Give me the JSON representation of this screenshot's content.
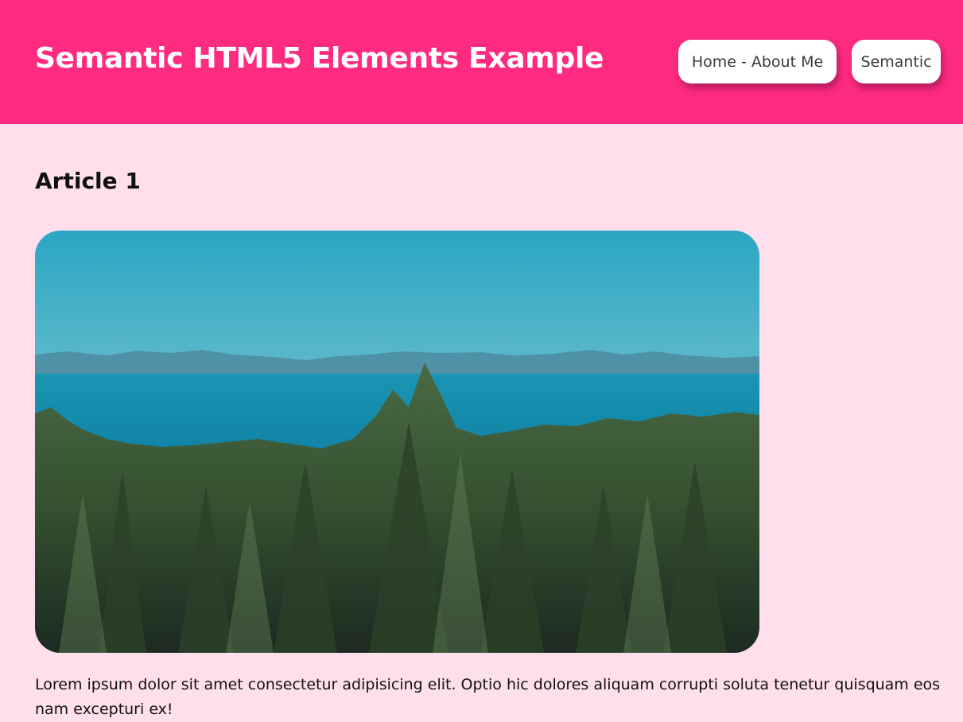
{
  "header": {
    "title": "Semantic HTML5 Elements Example",
    "background": "#ff2b81"
  },
  "nav": {
    "items": [
      {
        "label": "Home - About Me"
      },
      {
        "label": "Semantic"
      }
    ]
  },
  "page": {
    "background": "#ffdfec"
  },
  "article": {
    "title": "Article 1",
    "image_icon": "landscape-photo-forest-sea-mountains",
    "text": "Lorem ipsum dolor sit amet consectetur adipisicing elit. Optio hic dolores aliquam corrupti soluta tenetur quisquam eos nam excepturi ex!"
  }
}
